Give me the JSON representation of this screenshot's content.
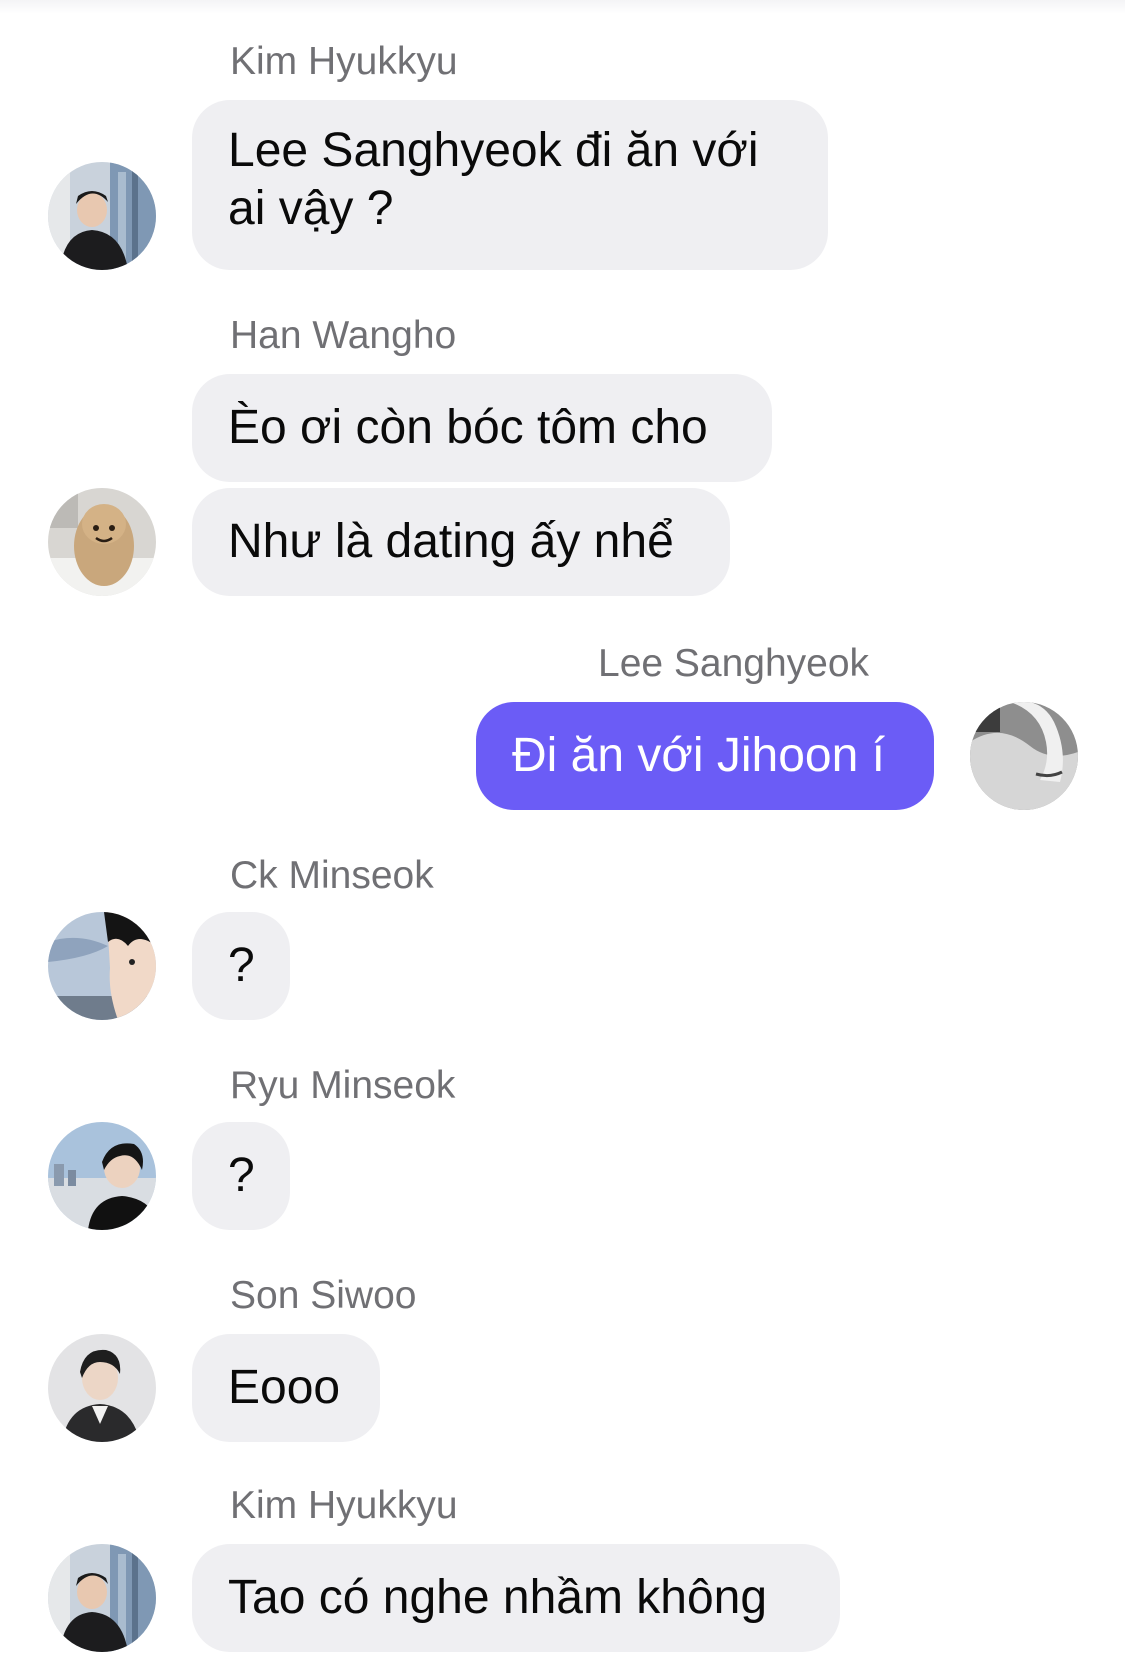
{
  "messages": [
    {
      "sender": "Kim Hyukkyu",
      "text": "Lee Sanghyeok đi ăn với ai vậy ?"
    },
    {
      "sender": "Han Wangho",
      "text": "Èo ơi còn bóc tôm cho"
    },
    {
      "sender": "",
      "text": "Như là dating ấy nhể"
    },
    {
      "sender": "Lee Sanghyeok",
      "text": "Đi ăn với Jihoon í",
      "own": true
    },
    {
      "sender": "Ck Minseok",
      "text": "?"
    },
    {
      "sender": "Ryu Minseok",
      "text": "?"
    },
    {
      "sender": "Son Siwoo",
      "text": "Eooo"
    },
    {
      "sender": "Kim Hyukkyu",
      "text": "Tao có nghe nhầm không"
    }
  ],
  "avatars": [
    {
      "user": "Kim Hyukkyu",
      "icon": "person-photo"
    },
    {
      "user": "Han Wangho",
      "icon": "plush-toy-photo"
    },
    {
      "user": "Lee Sanghyeok",
      "icon": "grayscale-photo"
    },
    {
      "user": "Ck Minseok",
      "icon": "person-sky-photo"
    },
    {
      "user": "Ryu Minseok",
      "icon": "person-city-photo"
    },
    {
      "user": "Son Siwoo",
      "icon": "person-portrait-photo"
    },
    {
      "user": "Kim Hyukkyu",
      "icon": "person-photo"
    }
  ],
  "colors": {
    "incoming_bubble": "#efeff2",
    "outgoing_bubble": "#6b5cf6",
    "sender_name": "#707074"
  }
}
